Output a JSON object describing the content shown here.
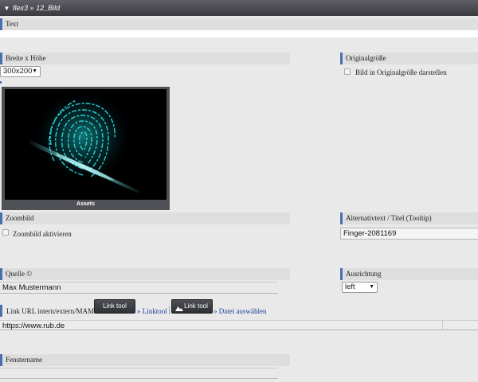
{
  "header": {
    "breadcrumb_1": "flex3",
    "separator": "»",
    "breadcrumb_2": "12_Bild"
  },
  "fields": {
    "text_label": "Text",
    "size_label": "Breite x Höhe",
    "size_value": "300x200",
    "original_label": "Originalgröße",
    "original_checkbox": "Bild in Originalgröße darstellen",
    "image_caption": "Assets",
    "zoom_label": "Zoombild",
    "zoom_checkbox": "Zoombild aktivieren",
    "alt_label": "Alternativtext / Titel (Tooltip)",
    "alt_value": "Finger-2081169",
    "source_label": "Quelle ©",
    "source_value": "Max Mustermann",
    "align_label": "Ausrichtung",
    "align_value": "left",
    "link_label": "Link URL intern/extern/MAM",
    "linktool_btn": "Link tool",
    "linktool_link": "» Linktool",
    "filetool_btn": "Link tool",
    "file_link": "» Datei auswählen",
    "url_value": "https://www.rub.de",
    "window_label": "Fenstername",
    "window_value": ""
  },
  "icons": {
    "header": "triangle-down-icon",
    "select": "caret-down-icon",
    "image": "fingerprint-image",
    "mountain": "mountain-icon"
  },
  "colors": {
    "accent": "#4a6fae",
    "link": "#1a3f9c",
    "header_bg": "#45464b"
  }
}
